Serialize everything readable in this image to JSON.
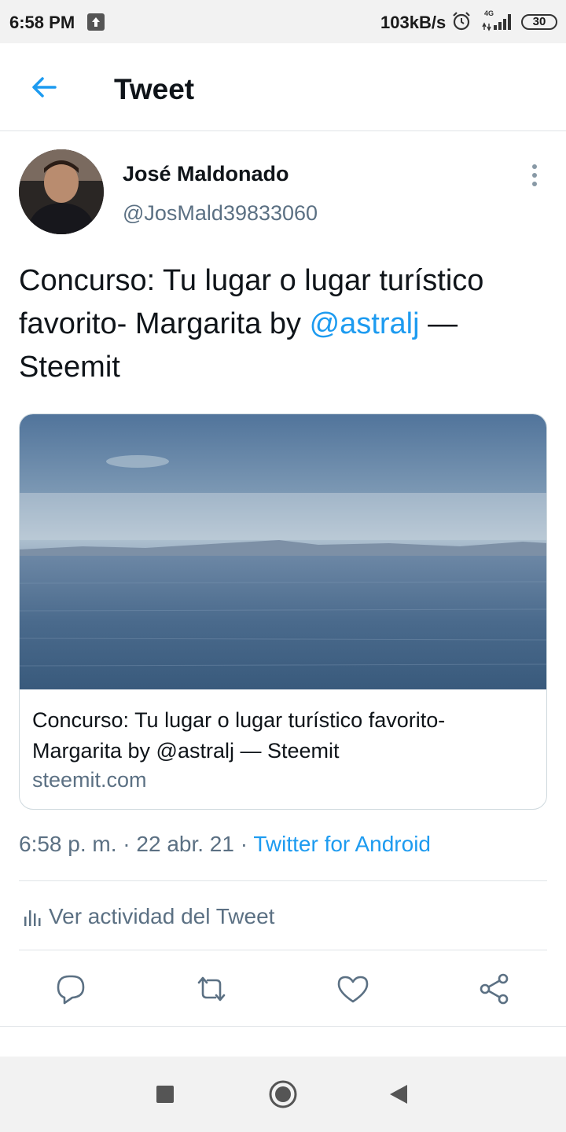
{
  "status_bar": {
    "time": "6:58 PM",
    "speed": "103kB/s",
    "network_label": "4G",
    "battery": "30",
    "icons": [
      "upload-icon",
      "alarm-icon",
      "signal-icon",
      "battery-icon"
    ]
  },
  "header": {
    "title": "Tweet",
    "back_icon": "arrow-left-icon"
  },
  "tweet": {
    "author_name": "José Maldonado",
    "author_handle": "@JosMald39833060",
    "text_before": "Concurso: Tu lugar o lugar turístico favorito- Margarita by ",
    "mention": "@astralj",
    "text_after": " — Steemit",
    "card": {
      "title": "Concurso: Tu lugar o lugar turístico favorito- Margarita by @astralj — Steemit",
      "domain": "steemit.com"
    },
    "meta_time": "6:58 p. m. · 22 abr. 21 · ",
    "meta_source": "Twitter for Android",
    "activity_label": "Ver actividad del Tweet"
  },
  "actions": [
    "reply-icon",
    "retweet-icon",
    "like-icon",
    "share-icon"
  ],
  "colors": {
    "accent": "#1d9bf0",
    "secondary_text": "#5b7083",
    "primary_text": "#0f1419",
    "divider": "#dfe3e7"
  },
  "nav": [
    "recents-square-icon",
    "home-circle-icon",
    "back-triangle-icon"
  ]
}
